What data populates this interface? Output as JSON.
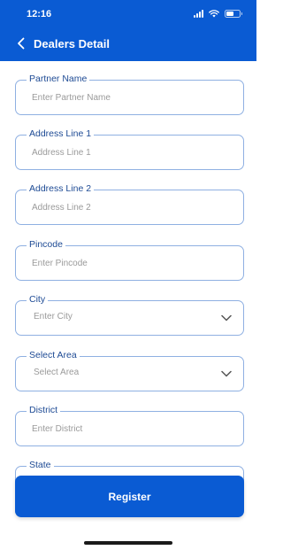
{
  "status_bar": {
    "time": "12:16"
  },
  "app_bar": {
    "title": "Dealers Detail"
  },
  "form": {
    "fields": [
      {
        "label": "Partner Name",
        "placeholder": "Enter Partner Name"
      },
      {
        "label": "Address Line 1",
        "placeholder": "Address Line 1"
      },
      {
        "label": "Address Line 2",
        "placeholder": "Address Line 2"
      },
      {
        "label": "Pincode",
        "placeholder": "Enter Pincode"
      },
      {
        "label": "City",
        "placeholder": "Enter City"
      },
      {
        "label": "Select Area",
        "placeholder": "Select Area"
      },
      {
        "label": "District",
        "placeholder": "Enter District"
      },
      {
        "label": "State",
        "placeholder": ""
      }
    ]
  },
  "register_button": {
    "label": "Register"
  },
  "colors": {
    "primary": "#0a5bd3",
    "field_border": "#8fb0e2",
    "label": "#1d4a94"
  },
  "icons": {
    "back": "chevron-left-icon",
    "dropdown": "chevron-down-icon",
    "signal": "signal-icon",
    "wifi": "wifi-icon",
    "battery": "battery-icon"
  }
}
